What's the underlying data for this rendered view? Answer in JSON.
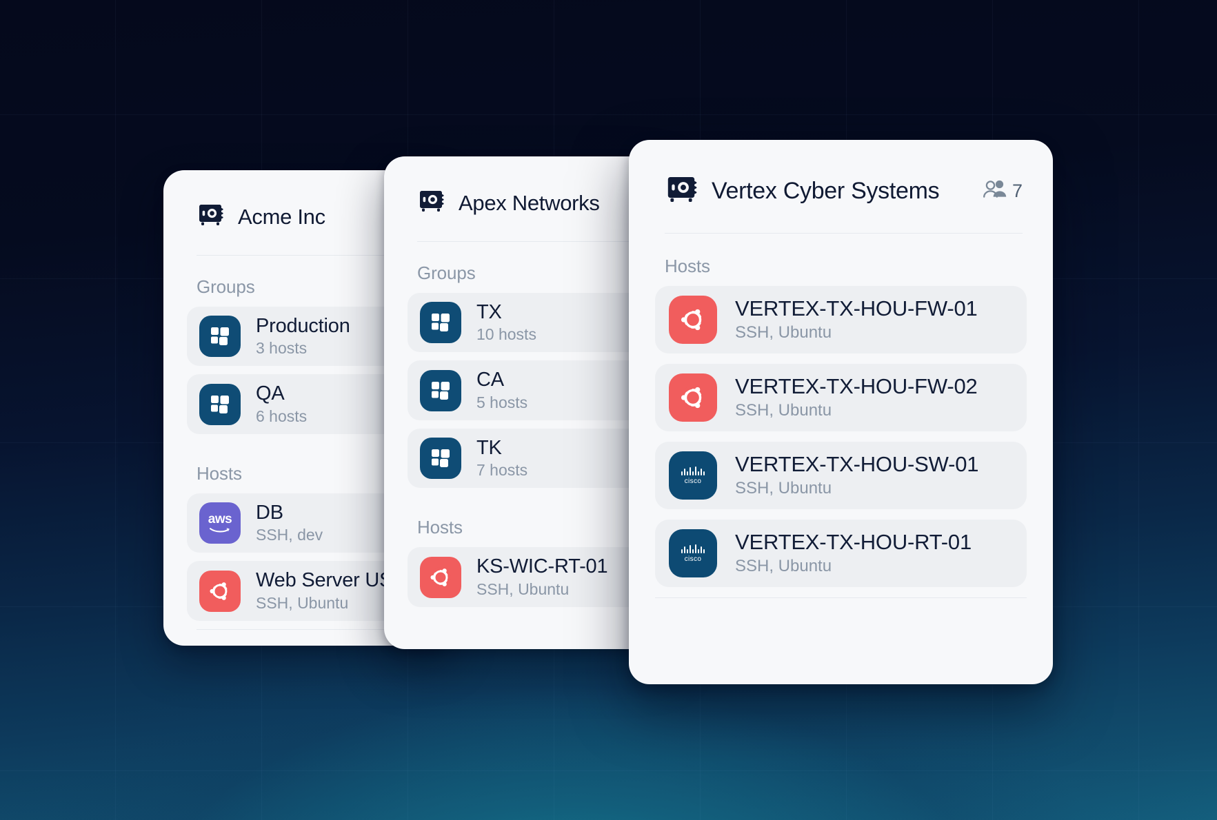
{
  "background": {
    "top_color": "#05091c",
    "glow_color": "#1896a0",
    "bottom_color": "#14607e"
  },
  "cards": [
    {
      "id": "acme",
      "title": "Acme Inc",
      "logo_icon": "safe-icon",
      "sections": [
        {
          "label": "Groups",
          "rows": [
            {
              "icon": "group-icon",
              "icon_style": "icon-group",
              "title": "Production",
              "subtitle": "3 hosts"
            },
            {
              "icon": "group-icon",
              "icon_style": "icon-group",
              "title": "QA",
              "subtitle": "6 hosts"
            }
          ]
        },
        {
          "label": "Hosts",
          "rows": [
            {
              "icon": "aws-icon",
              "icon_style": "icon-aws",
              "title": "DB",
              "subtitle": "SSH, dev",
              "mark": "aws"
            },
            {
              "icon": "ubuntu-icon",
              "icon_style": "icon-ubuntu",
              "title": "Web Server US",
              "subtitle": "SSH, Ubuntu"
            }
          ]
        }
      ]
    },
    {
      "id": "apex",
      "title": "Apex Networks",
      "logo_icon": "safe-icon",
      "sections": [
        {
          "label": "Groups",
          "rows": [
            {
              "icon": "group-icon",
              "icon_style": "icon-group",
              "title": "TX",
              "subtitle": "10 hosts"
            },
            {
              "icon": "group-icon",
              "icon_style": "icon-group",
              "title": "CA",
              "subtitle": "5 hosts"
            },
            {
              "icon": "group-icon",
              "icon_style": "icon-group",
              "title": "TK",
              "subtitle": "7 hosts"
            }
          ]
        },
        {
          "label": "Hosts",
          "rows": [
            {
              "icon": "ubuntu-icon",
              "icon_style": "icon-ubuntu",
              "title": "KS-WIC-RT-01",
              "subtitle": "SSH, Ubuntu"
            }
          ]
        }
      ]
    },
    {
      "id": "vertex",
      "title": "Vertex Cyber Systems",
      "logo_icon": "safe-icon",
      "members_icon": "users-icon",
      "members_count": "7",
      "sections": [
        {
          "label": "Hosts",
          "rows": [
            {
              "icon": "ubuntu-icon",
              "icon_style": "icon-ubuntu",
              "title": "VERTEX-TX-HOU-FW-01",
              "subtitle": "SSH, Ubuntu"
            },
            {
              "icon": "ubuntu-icon",
              "icon_style": "icon-ubuntu",
              "title": "VERTEX-TX-HOU-FW-02",
              "subtitle": "SSH, Ubuntu"
            },
            {
              "icon": "cisco-icon",
              "icon_style": "icon-cisco",
              "title": "VERTEX-TX-HOU-SW-01",
              "subtitle": "SSH, Ubuntu",
              "mark": "cisco"
            },
            {
              "icon": "cisco-icon",
              "icon_style": "icon-cisco",
              "title": "VERTEX-TX-HOU-RT-01",
              "subtitle": "SSH, Ubuntu",
              "mark": "cisco"
            }
          ]
        }
      ]
    }
  ],
  "wordmarks": {
    "aws": "aws",
    "cisco": "cisco"
  }
}
